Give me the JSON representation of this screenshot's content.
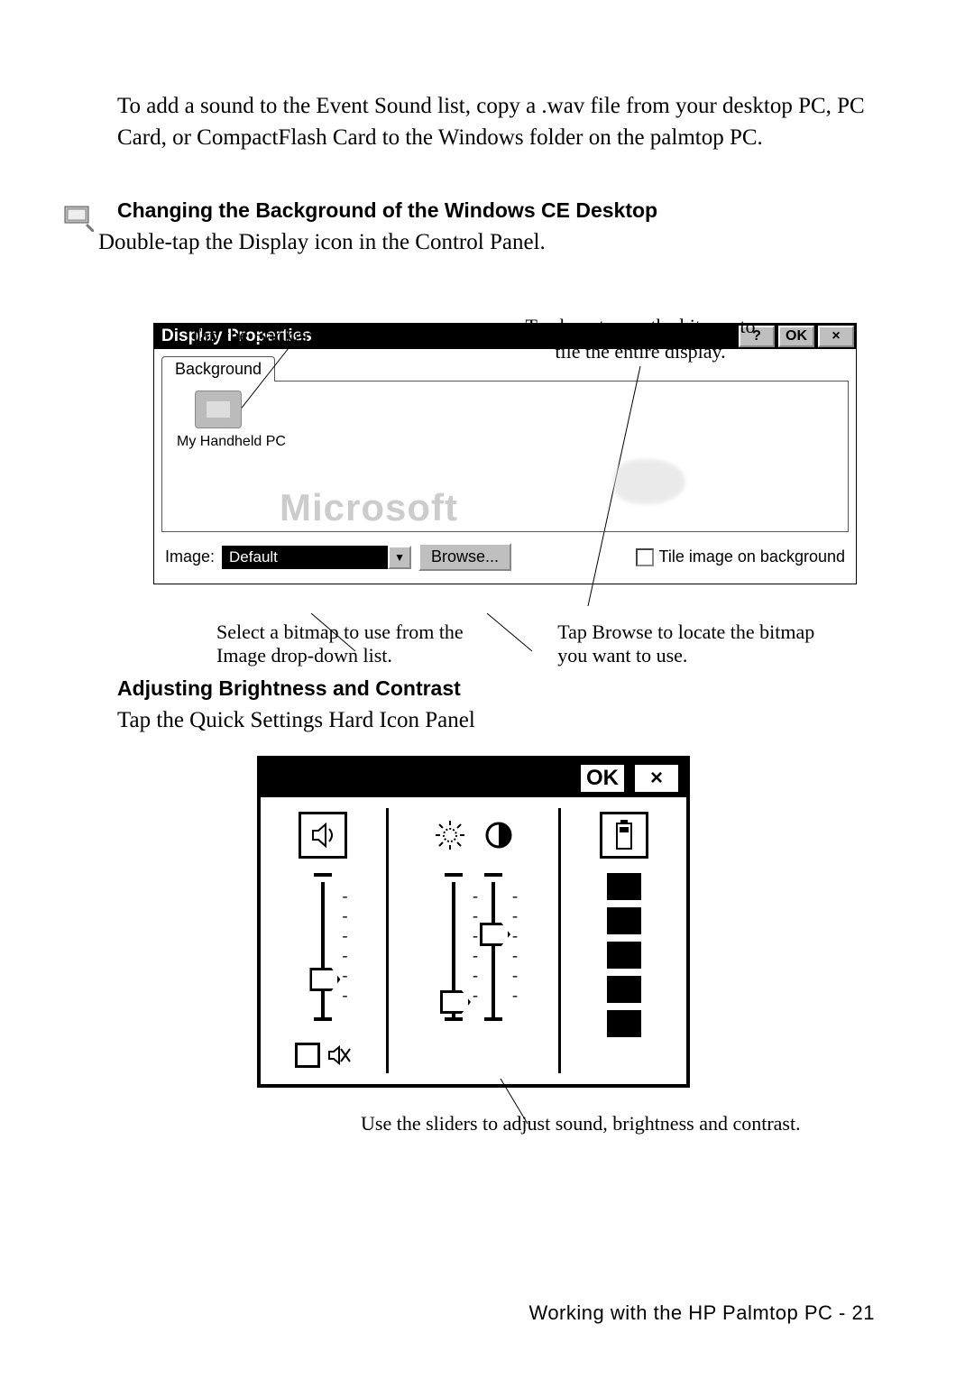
{
  "intro_paragraph": "To add a sound to the Event Sound list, copy a .wav file from your desktop PC, PC Card, or CompactFlash Card to the Windows folder on the palmtop PC.",
  "headings": {
    "background": "Changing the Background of the Windows CE Desktop",
    "brightness": "Adjusting Brightness and Contrast"
  },
  "bg_instruction": "Double-tap the Display icon in the Control Panel.",
  "dp": {
    "callout_tab": "Tap the Background tab.",
    "callout_tile": "Tap here to use the bitmap to tile the entire display.",
    "title": "Display Properties",
    "help": "?",
    "ok": "OK",
    "close": "×",
    "tab_label": "Background",
    "handheld_label": "My Handheld PC",
    "watermark": "Microsoft",
    "image_label": "Image:",
    "image_value": "Default",
    "dropdown_arrow": "▼",
    "browse": "Browse...",
    "tile_label": "Tile image on background",
    "callout_image": "Select a bitmap to use from the Image drop-down list.",
    "callout_browse": "Tap Browse to locate the bitmap you want to use."
  },
  "qs": {
    "instruction": "Tap the Quick Settings Hard Icon Panel",
    "ok": "OK",
    "close": "×",
    "caption": "Use the sliders to adjust sound, brightness and contrast."
  },
  "footer": {
    "text": "Working with the HP Palmtop PC -",
    "page": "21"
  }
}
